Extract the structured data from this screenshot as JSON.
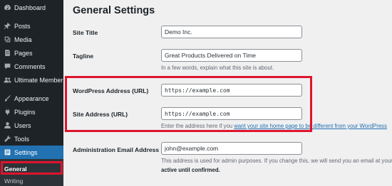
{
  "sidebar": {
    "items": [
      {
        "label": "Dashboard",
        "icon": "dashboard-icon"
      },
      {
        "label": "Posts",
        "icon": "pin-icon"
      },
      {
        "label": "Media",
        "icon": "media-icon"
      },
      {
        "label": "Pages",
        "icon": "pages-icon"
      },
      {
        "label": "Comments",
        "icon": "comment-icon"
      },
      {
        "label": "Ultimate Member",
        "icon": "user-group-icon"
      },
      {
        "label": "Appearance",
        "icon": "brush-icon"
      },
      {
        "label": "Plugins",
        "icon": "plug-icon"
      },
      {
        "label": "Users",
        "icon": "user-icon"
      },
      {
        "label": "Tools",
        "icon": "wrench-icon"
      },
      {
        "label": "Settings",
        "icon": "settings-icon"
      }
    ],
    "submenu": {
      "current": "General",
      "next": "Writing"
    }
  },
  "main": {
    "title": "General Settings",
    "site_title": {
      "label": "Site Title",
      "value": "Demo Inc."
    },
    "tagline": {
      "label": "Tagline",
      "value": "Great Products Delivered on Time",
      "description": "In a few words, explain what this site is about."
    },
    "wp_address": {
      "label": "WordPress Address (URL)",
      "value": "https://example.com"
    },
    "site_address": {
      "label": "Site Address (URL)",
      "value": "https://example.com",
      "description_prefix": "Enter the address here if you ",
      "description_link": "want your site home page to be different from your WordPress"
    },
    "admin_email": {
      "label": "Administration Email Address",
      "value": "john@example.com",
      "description_line1": "This address is used for admin purposes. If you change this, we will send you an email at your",
      "description_line2": "active until confirmed."
    }
  },
  "colors": {
    "sidebar_bg": "#1d2327",
    "accent": "#2271b1",
    "highlight": "#e0142d"
  }
}
